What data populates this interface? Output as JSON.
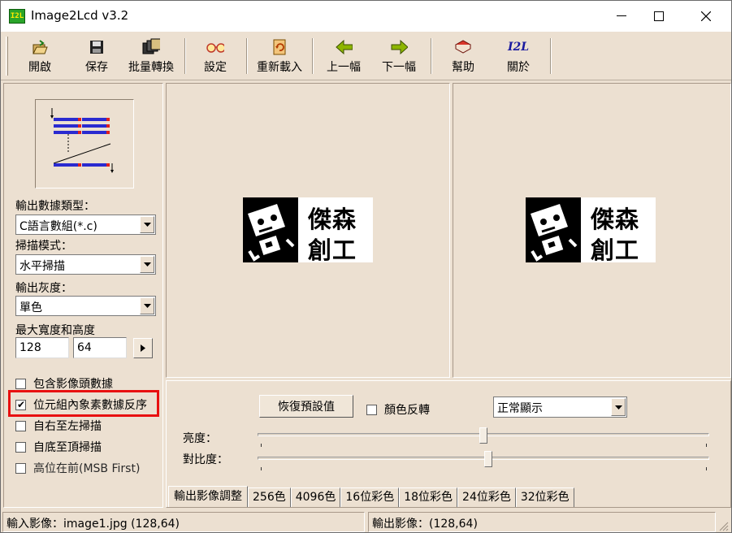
{
  "window": {
    "app_icon_text": "I2L",
    "title": "Image2Lcd v3.2"
  },
  "toolbar": {
    "open": "開啟",
    "save": "保存",
    "batch": "批量轉換",
    "settings": "設定",
    "reload": "重新載入",
    "prev": "上一幅",
    "next": "下一幅",
    "help": "幫助",
    "about": "關於",
    "about_icon_text": "I2L"
  },
  "left": {
    "output_type_label": "輸出數據類型：",
    "output_type_value": "C語言數組(*.c)",
    "scan_mode_label": "掃描模式：",
    "scan_mode_value": "水平掃描",
    "gray_label": "輸出灰度：",
    "gray_value": "單色",
    "max_size_label": "最大寬度和高度",
    "width_value": "128",
    "height_value": "64",
    "checkboxes": [
      {
        "label": "包含影像頭數據",
        "checked": false
      },
      {
        "label": "位元組內象素數據反序",
        "checked": true
      },
      {
        "label": "自右至左掃描",
        "checked": false
      },
      {
        "label": "自底至頂掃描",
        "checked": false
      },
      {
        "label": "高位在前(MSB First)",
        "checked": false
      }
    ]
  },
  "preview": {
    "logo_line1": "傑森",
    "logo_line2": "創工"
  },
  "adjust": {
    "reset_button": "恢復預設值",
    "invert_label": "顏色反轉",
    "display_mode": "正常顯示",
    "brightness_label": "亮度：",
    "contrast_label": "對比度：",
    "brightness_level": 0.5,
    "contrast_level": 0.51
  },
  "tabs": [
    "輸出影像調整",
    "256色",
    "4096色",
    "16位彩色",
    "18位彩色",
    "24位彩色",
    "32位彩色"
  ],
  "status": {
    "input": "輸入影像：image1.jpg (128,64)",
    "output": "輸出影像：(128,64)"
  }
}
